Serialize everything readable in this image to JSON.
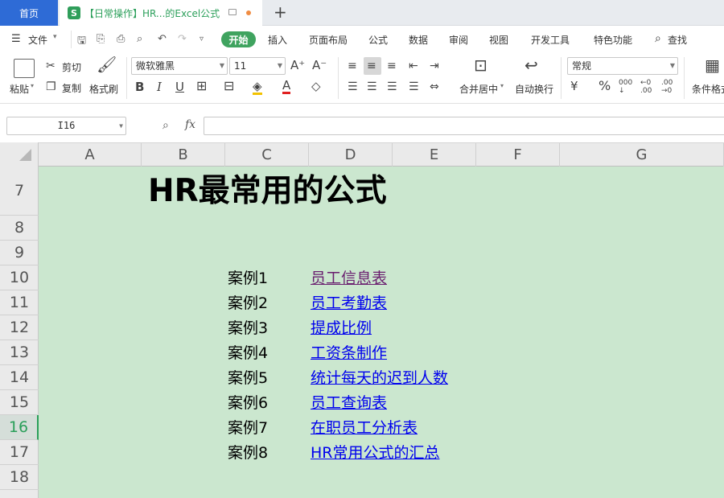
{
  "tabs": {
    "home": "首页",
    "doc_title": "【日常操作】HR...的Excel公式",
    "doc_icon_letter": "S"
  },
  "menu": {
    "file": "文件",
    "start": "开始",
    "items": [
      "插入",
      "页面布局",
      "公式",
      "数据",
      "审阅",
      "视图",
      "开发工具",
      "特色功能"
    ],
    "search": "查找"
  },
  "ribbon": {
    "paste": "粘贴",
    "cut": "剪切",
    "copy": "复制",
    "format_painter": "格式刷",
    "font_name": "微软雅黑",
    "font_size": "11",
    "merge_center": "合并居中",
    "wrap_text": "自动换行",
    "number_format": "常规",
    "conditional_format": "条件格式"
  },
  "formula_bar": {
    "cell_ref": "I16",
    "fx_label": "fx",
    "value": ""
  },
  "columns": [
    "A",
    "B",
    "C",
    "D",
    "E",
    "F",
    "G"
  ],
  "rows": [
    "7",
    "8",
    "9",
    "10",
    "11",
    "12",
    "13",
    "14",
    "15",
    "16",
    "17",
    "18"
  ],
  "selected_row": "16",
  "sheet": {
    "title": "HR最常用的公式",
    "cases": [
      {
        "label": "案例1",
        "link": "员工信息表",
        "visited": true
      },
      {
        "label": "案例2",
        "link": "员工考勤表",
        "visited": false
      },
      {
        "label": "案例3",
        "link": "提成比例",
        "visited": false
      },
      {
        "label": "案例4",
        "link": "工资条制作",
        "visited": false
      },
      {
        "label": "案例5",
        "link": "统计每天的迟到人数",
        "visited": false
      },
      {
        "label": "案例6",
        "link": "员工查询表",
        "visited": false
      },
      {
        "label": "案例7",
        "link": "在职员工分析表",
        "visited": false
      },
      {
        "label": "案例8",
        "link": "HR常用公式的汇总",
        "visited": false
      }
    ]
  },
  "colors": {
    "accent_blue": "#2e6bd6",
    "accent_green": "#3fa35f",
    "sheet_bg": "#cbe7cf",
    "link": "#0000ee",
    "link_visited": "#6a1e6f"
  }
}
